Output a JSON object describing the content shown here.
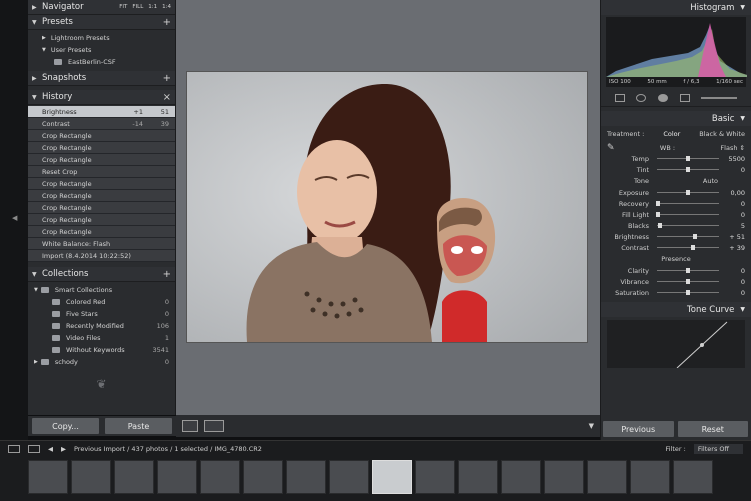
{
  "left": {
    "navigator": {
      "title": "Navigator",
      "opts": [
        "FIT",
        "FILL",
        "1:1",
        "1:4"
      ]
    },
    "presets": {
      "title": "Presets",
      "items": [
        {
          "label": "Lightroom Presets",
          "indent": 1
        },
        {
          "label": "User Presets",
          "indent": 1
        },
        {
          "label": "EastBerlin-CSF",
          "indent": 2
        }
      ]
    },
    "snapshots": {
      "title": "Snapshots"
    },
    "history": {
      "title": "History",
      "close": "×",
      "items": [
        {
          "label": "Brightness",
          "a": "+1",
          "b": "51",
          "sel": true
        },
        {
          "label": "Contrast",
          "a": "-14",
          "b": "39"
        },
        {
          "label": "Crop Rectangle"
        },
        {
          "label": "Crop Rectangle"
        },
        {
          "label": "Crop Rectangle"
        },
        {
          "label": "Reset Crop"
        },
        {
          "label": "Crop Rectangle"
        },
        {
          "label": "Crop Rectangle"
        },
        {
          "label": "Crop Rectangle"
        },
        {
          "label": "Crop Rectangle"
        },
        {
          "label": "Crop Rectangle"
        },
        {
          "label": "White Balance: Flash"
        },
        {
          "label": "Import (8.4.2014 10:22:52)"
        }
      ]
    },
    "collections": {
      "title": "Collections",
      "items": [
        {
          "label": "Smart Collections",
          "count": ""
        },
        {
          "label": "Colored Red",
          "count": "0"
        },
        {
          "label": "Five Stars",
          "count": "0"
        },
        {
          "label": "Recently Modified",
          "count": "106"
        },
        {
          "label": "Video Files",
          "count": "1"
        },
        {
          "label": "Without Keywords",
          "count": "3541"
        },
        {
          "label": "schody",
          "count": "0"
        }
      ]
    },
    "buttons": {
      "copy": "Copy...",
      "paste": "Paste"
    }
  },
  "right": {
    "histogram": {
      "title": "Histogram",
      "iso": "ISO 100",
      "focal": "50 mm",
      "aperture": "f / 6,3",
      "shutter": "1/160 sec"
    },
    "basic": {
      "title": "Basic",
      "treatment_label": "Treatment :",
      "color": "Color",
      "bw": "Black & White",
      "wb_label": "WB :",
      "wb_value": "Flash",
      "tone_label": "Tone",
      "auto": "Auto",
      "presence_label": "Presence",
      "sliders_wb": [
        {
          "label": "Temp",
          "val": "5500",
          "pos": 0.5
        },
        {
          "label": "Tint",
          "val": "0",
          "pos": 0.5
        }
      ],
      "sliders_tone": [
        {
          "label": "Exposure",
          "val": "0,00",
          "pos": 0.5
        },
        {
          "label": "Recovery",
          "val": "0",
          "pos": 0.02
        },
        {
          "label": "Fill Light",
          "val": "0",
          "pos": 0.02
        },
        {
          "label": "Blacks",
          "val": "5",
          "pos": 0.05
        },
        {
          "label": "Brightness",
          "val": "+ 51",
          "pos": 0.62
        },
        {
          "label": "Contrast",
          "val": "+ 39",
          "pos": 0.58
        }
      ],
      "sliders_presence": [
        {
          "label": "Clarity",
          "val": "0",
          "pos": 0.5
        },
        {
          "label": "Vibrance",
          "val": "0",
          "pos": 0.5
        },
        {
          "label": "Saturation",
          "val": "0",
          "pos": 0.5
        }
      ]
    },
    "tone_curve": {
      "title": "Tone Curve"
    },
    "buttons": {
      "previous": "Previous",
      "reset": "Reset"
    }
  },
  "bottom": {
    "breadcrumb": "Previous Import / 437 photos / 1 selected / IMG_4780.CR2",
    "filter_label": "Filter :",
    "filter_value": "Filters Off"
  }
}
